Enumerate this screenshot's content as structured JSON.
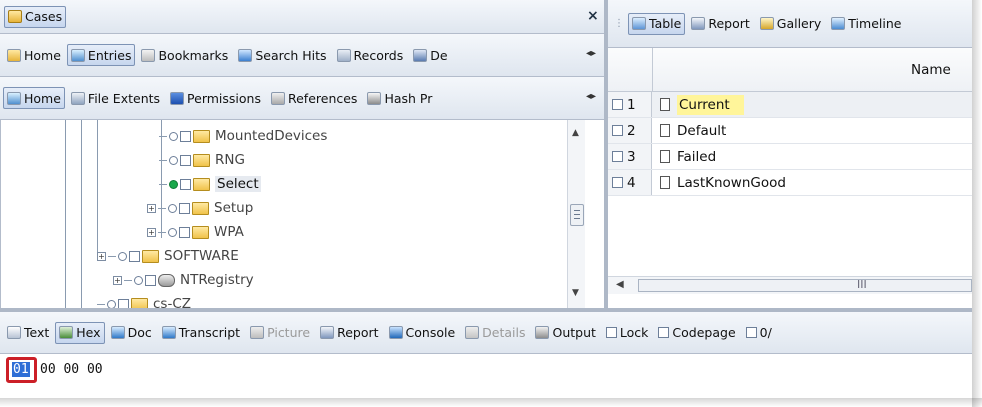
{
  "cases_tab": {
    "label": "Cases",
    "close": "×"
  },
  "view_tabs": [
    {
      "label": "Table",
      "icon": "table-icon",
      "selected": true
    },
    {
      "label": "Report",
      "icon": "report-icon",
      "selected": false
    },
    {
      "label": "Gallery",
      "icon": "gallery-icon",
      "selected": false
    },
    {
      "label": "Timeline",
      "icon": "timeline-icon",
      "selected": false
    }
  ],
  "nav_tabs": [
    {
      "label": "Home",
      "icon": "home-icon",
      "selected": false
    },
    {
      "label": "Entries",
      "icon": "tree-icon",
      "selected": true
    },
    {
      "label": "Bookmarks",
      "icon": "bookmarks-icon",
      "selected": false
    },
    {
      "label": "Search Hits",
      "icon": "search-icon",
      "selected": false
    },
    {
      "label": "Records",
      "icon": "records-icon",
      "selected": false
    },
    {
      "label": "De",
      "icon": "devices-icon",
      "selected": false
    }
  ],
  "sub_tabs": [
    {
      "label": "Home",
      "icon": "tree-icon",
      "selected": true
    },
    {
      "label": "File Extents",
      "icon": "extents-icon",
      "selected": false
    },
    {
      "label": "Permissions",
      "icon": "lock-icon",
      "selected": false
    },
    {
      "label": "References",
      "icon": "references-icon",
      "selected": false
    },
    {
      "label": "Hash Pr",
      "icon": "hash-icon",
      "selected": false
    }
  ],
  "tree": {
    "nodes": [
      {
        "label": "MountedDevices"
      },
      {
        "label": "RNG"
      },
      {
        "label": "Select"
      },
      {
        "label": "Setup"
      },
      {
        "label": "WPA"
      },
      {
        "label": "SOFTWARE"
      },
      {
        "label": "NTRegistry"
      },
      {
        "label": "cs-CZ"
      }
    ]
  },
  "table": {
    "header_name": "Name",
    "rows": [
      {
        "num": "1",
        "name": "Current",
        "highlighted": true
      },
      {
        "num": "2",
        "name": "Default",
        "highlighted": false
      },
      {
        "num": "3",
        "name": "Failed",
        "highlighted": false
      },
      {
        "num": "4",
        "name": "LastKnownGood",
        "highlighted": false
      }
    ],
    "hscroll_grip": "III"
  },
  "bottom_tabs": [
    {
      "label": "Text",
      "icon": "text-icon",
      "selected": false,
      "disabled": false
    },
    {
      "label": "Hex",
      "icon": "hex-icon",
      "selected": true,
      "disabled": false
    },
    {
      "label": "Doc",
      "icon": "doc-icon",
      "selected": false,
      "disabled": false
    },
    {
      "label": "Transcript",
      "icon": "transcript-icon",
      "selected": false,
      "disabled": false
    },
    {
      "label": "Picture",
      "icon": "picture-icon",
      "selected": false,
      "disabled": true
    },
    {
      "label": "Report",
      "icon": "report-icon",
      "selected": false,
      "disabled": false
    },
    {
      "label": "Console",
      "icon": "console-icon",
      "selected": false,
      "disabled": false
    },
    {
      "label": "Details",
      "icon": "details-icon",
      "selected": false,
      "disabled": true
    },
    {
      "label": "Output",
      "icon": "output-icon",
      "selected": false,
      "disabled": false
    }
  ],
  "bottom_checks": [
    {
      "label": "Lock"
    },
    {
      "label": "Codepage"
    },
    {
      "label": "0/"
    }
  ],
  "hex": {
    "first_byte": "01",
    "rest": "00 00 00"
  },
  "colors": {
    "highlight": "#fff59a",
    "selection_outline": "#cc1f27",
    "hex_selection": "#2f6fd6",
    "accent": "#7d93b5"
  }
}
